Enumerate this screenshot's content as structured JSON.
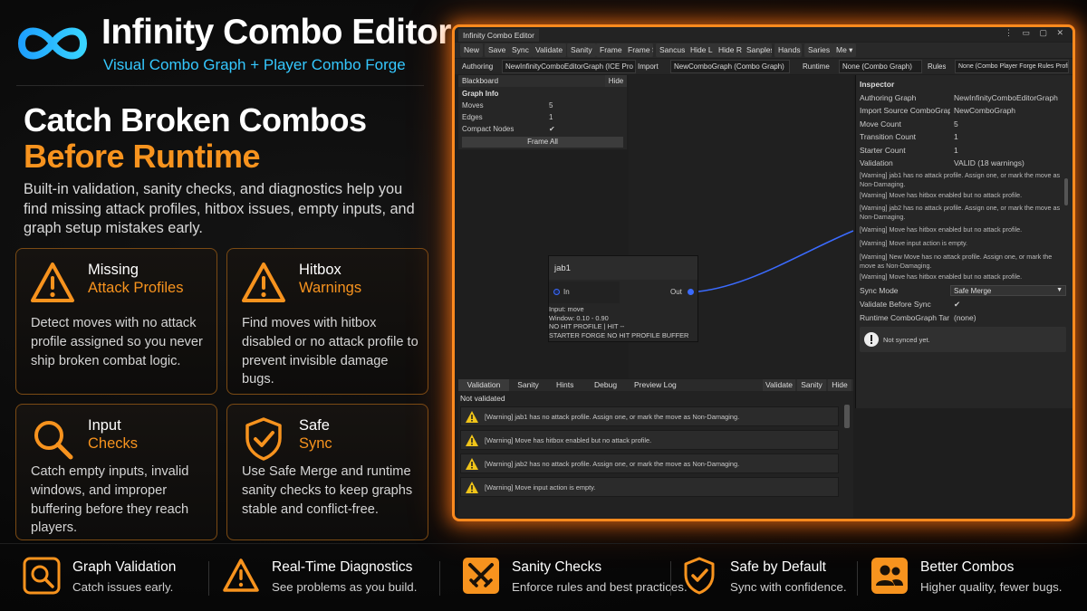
{
  "brand": {
    "title": "Infinity Combo Editor",
    "subtitle": "Visual Combo Graph + Player Combo Forge",
    "logo_icon": "infinity-logo-icon"
  },
  "hero": {
    "headline_line1": "Catch Broken Combos",
    "headline_line2": "Before Runtime",
    "description": "Built-in validation, sanity checks, and diagnostics help you find missing attack profiles, hitbox issues, empty inputs, and graph setup mistakes early."
  },
  "cards": [
    {
      "icon": "warning-triangle-icon",
      "title_white": "Missing",
      "title_orange": "Attack Profiles",
      "description": "Detect moves with no attack profile assigned so you never ship broken combat logic."
    },
    {
      "icon": "warning-triangle-icon",
      "title_white": "Hitbox",
      "title_orange": "Warnings",
      "description": "Find moves with hitbox disabled or no attack profile to prevent invisible damage bugs."
    },
    {
      "icon": "magnifier-icon",
      "title_white": "Input",
      "title_orange": "Checks",
      "description": "Catch empty inputs, invalid windows, and improper buffering before they reach players."
    },
    {
      "icon": "shield-check-icon",
      "title_white": "Safe",
      "title_orange": "Sync",
      "description": "Use Safe Merge and runtime sanity checks to keep graphs stable and conflict-free."
    }
  ],
  "features": [
    {
      "icon": "search-graph-icon",
      "title": "Graph Validation",
      "desc": "Catch issues early."
    },
    {
      "icon": "warning-triangle-icon",
      "title": "Real-Time Diagnostics",
      "desc": "See problems as you build."
    },
    {
      "icon": "crossed-swords-icon",
      "title": "Sanity Checks",
      "desc": "Enforce rules and best practices."
    },
    {
      "icon": "shield-check-icon",
      "title": "Safe by Default",
      "desc": "Sync with confidence."
    },
    {
      "icon": "users-icon",
      "title": "Better Combos",
      "desc": "Higher quality, fewer bugs."
    }
  ],
  "editor": {
    "tab_title": "Infinity Combo Editor",
    "window_buttons": "⋮ ▭ ▢ ✕",
    "toolbar": [
      "New",
      "Save",
      "Sync",
      "Validate",
      "Sanity",
      "Frame",
      "Frame S",
      "Sancus",
      "Hide L",
      "Hide R",
      "Sanples",
      "Hands",
      "Saries",
      "Me ▾"
    ],
    "objrow": {
      "authoring_label": "Authoring",
      "authoring_value": "NewInfinityComboEditorGraph (ICE Pro",
      "import_label": "Import",
      "import_value": "NewComboGraph (Combo Graph)",
      "runtime_label": "Runtime",
      "runtime_value": "None (Combo Graph)",
      "rules_label": "Rules",
      "rules_value": "None (Combo Player Forge Rules Profile)"
    },
    "blackboard": {
      "title": "Blackboard",
      "hide": "Hide",
      "section": "Graph Info",
      "rows": [
        {
          "label": "Moves",
          "value": "5"
        },
        {
          "label": "Edges",
          "value": "1"
        },
        {
          "label": "Compact Nodes",
          "value": "✔"
        }
      ],
      "frame_all": "Frame All"
    },
    "node": {
      "title": "jab1",
      "in": "In",
      "out": "Out",
      "lines": [
        "Input: move",
        "Window: 0.10 - 0.90",
        "NO HIT PROFILE | HIT --",
        "STARTER  FORGE  NO HIT PROFILE  BUFFER"
      ]
    },
    "inspector": {
      "title": "Inspector",
      "rows": [
        {
          "label": "Authoring Graph",
          "value": "NewInfinityComboEditorGraph"
        },
        {
          "label": "Import Source ComboGrap",
          "value": "NewComboGraph"
        },
        {
          "label": "Move Count",
          "value": "5"
        },
        {
          "label": "Transition Count",
          "value": "1"
        },
        {
          "label": "Starter Count",
          "value": "1"
        },
        {
          "label": "Validation",
          "value": "VALID (18 warnings)"
        }
      ],
      "warnings": [
        "[Warning] jab1 has no attack profile. Assign one, or mark the move as Non-Damaging.",
        "[Warning] Move has hitbox enabled but no attack profile.",
        "[Warning] jab2 has no attack profile. Assign one, or mark the move as Non-Damaging.",
        "[Warning] Move has hitbox enabled but no attack profile.",
        "[Warning] Move input action is empty.",
        "[Warning] New Move has no attack profile. Assign one, or mark the move as Non-Damaging.",
        "[Warning] Move has hitbox enabled but no attack profile."
      ],
      "sync_mode_label": "Sync Mode",
      "sync_mode_value": "Safe Merge",
      "validate_before_sync_label": "Validate Before Sync",
      "validate_before_sync_value": "✔",
      "runtime_target_label": "Runtime ComboGraph Tar",
      "runtime_target_value": "(none)",
      "not_synced": "Not synced yet."
    },
    "bottom_tabs_left": [
      "Validation",
      "Sanity",
      "Hints",
      "Debug",
      "Preview Log"
    ],
    "bottom_tabs_right": [
      "Validate",
      "Sanity",
      "Hide"
    ],
    "validation_status": "Not validated",
    "validation_rows": [
      "[Warning] jab1 has no attack profile. Assign one, or mark the move as Non-Damaging.",
      "[Warning] Move has hitbox enabled but no attack profile.",
      "[Warning] jab2 has no attack profile. Assign one, or mark the move as Non-Damaging.",
      "[Warning] Move input action is empty."
    ]
  },
  "colors": {
    "accent_orange": "#f7931e",
    "accent_blue": "#35c8ff",
    "warning_yellow": "#f0c419"
  }
}
